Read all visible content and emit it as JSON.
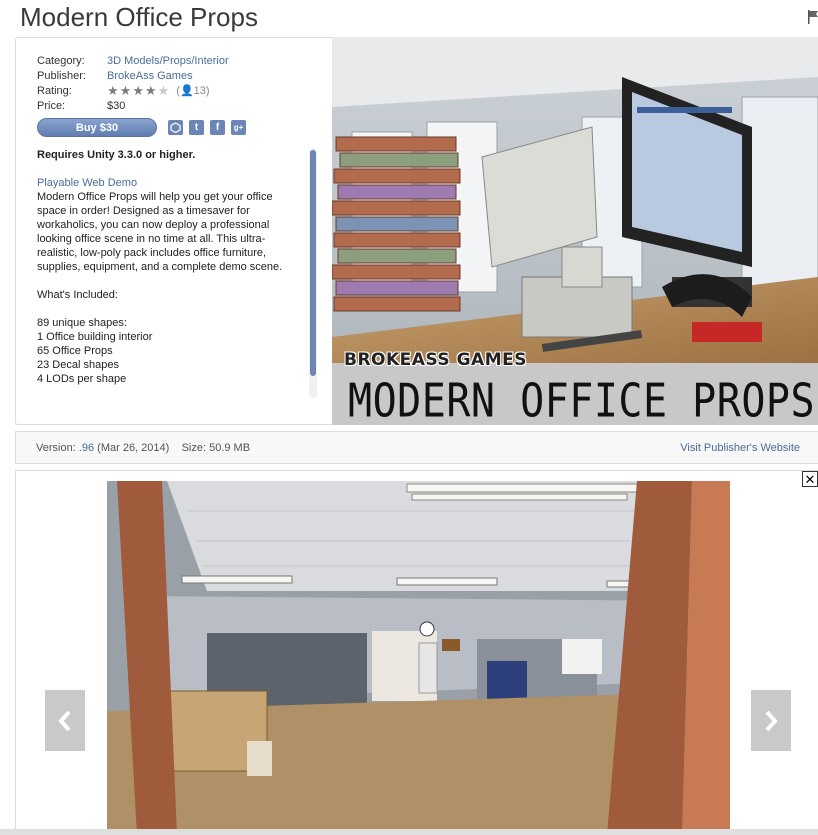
{
  "title": "Modern Office Props",
  "meta": {
    "category_label": "Category:",
    "category_value": "3D Models/Props/Interior",
    "publisher_label": "Publisher:",
    "publisher_value": "BrokeAss Games",
    "rating_label": "Rating:",
    "rating_stars_filled": 4,
    "rating_stars_total": 5,
    "rating_count": "(👤13)",
    "price_label": "Price:",
    "price_value": "$30"
  },
  "buy_label": "Buy $30",
  "share_icons": [
    "unity-icon",
    "twitter-icon",
    "facebook-icon",
    "google-plus-icon"
  ],
  "description": {
    "requirement": "Requires Unity 3.3.0 or higher.",
    "demo_link": "Playable Web Demo",
    "body": "Modern Office Props will help you get your office space in order! Designed as a timesaver for workaholics, you can now deploy a professional looking office scene in no time at all. This ultra-realistic, low-poly pack includes office furniture, supplies, equipment, and a complete demo scene.",
    "included_heading": "What's Included:",
    "included_items": [
      "89 unique shapes:",
      "1 Office building interior",
      "65 Office Props",
      "23 Decal shapes",
      "4 LODs per shape"
    ]
  },
  "hero": {
    "brand": "BROKEASS GAMES",
    "name": "MODERN OFFICE PROPS"
  },
  "version_bar": {
    "version_label": "Version:",
    "version_value": ".96",
    "date": "(Mar 26, 2014)",
    "size_label": "Size:",
    "size_value": "50.9 MB",
    "visit_link": "Visit Publisher's Website"
  },
  "gallery": {
    "prev_icon": "chevron-left-icon",
    "next_icon": "chevron-right-icon",
    "close_label": "✕"
  },
  "colors": {
    "link": "#4a6c99",
    "button": "#6f86b3"
  }
}
